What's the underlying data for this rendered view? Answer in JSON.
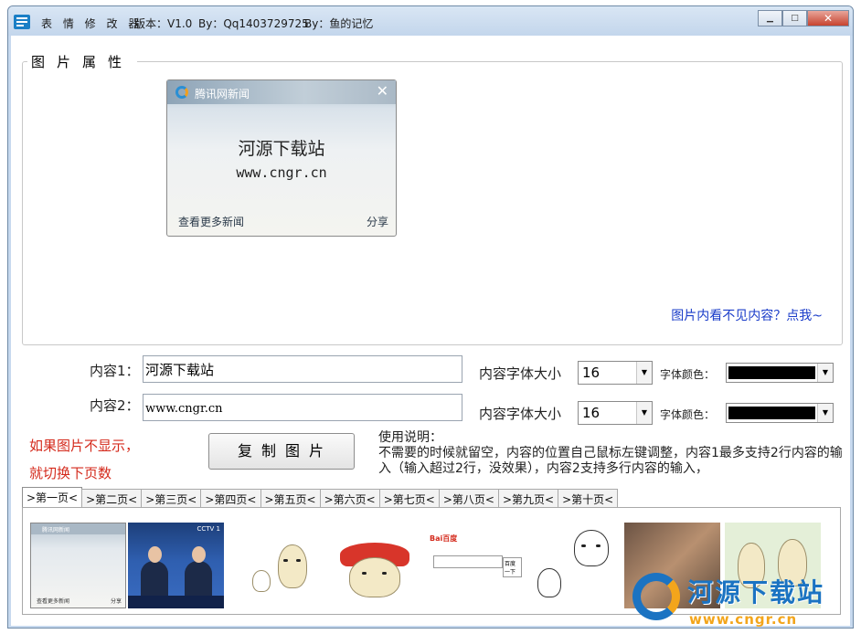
{
  "window": {
    "app_icon": "app-logo-icon",
    "title_name": "表 情 修 改 器",
    "title_version": "版本：V1.0",
    "title_by1": "By：Qq1403729725",
    "title_by2": "By：鱼的记忆",
    "controls": {
      "minimize": "▁",
      "maximize": "□",
      "close": "✕"
    }
  },
  "group": {
    "title": "图片属性"
  },
  "preview": {
    "brand": "腾讯网新闻",
    "close": "✕",
    "line1": "河源下载站",
    "line2": "www.cngr.cn",
    "more_link": "查看更多新闻",
    "share": "分享"
  },
  "help_link": "图片内看不见内容？点我~",
  "content1": {
    "label": "内容1：",
    "value": "河源下载站",
    "size_label": "内容字体大小",
    "size_value": "16",
    "color_label": "字体颜色：",
    "color_value": "#000000"
  },
  "content2": {
    "label": "内容2：",
    "value": "www.cngr.cn",
    "size_label": "内容字体大小",
    "size_value": "16",
    "color_label": "字体颜色：",
    "color_value": "#000000"
  },
  "notes": {
    "line1": "如果图片不显示，",
    "line2": "就切换下页数"
  },
  "copy_button": "复制图片",
  "usage": {
    "title": "使用说明：",
    "text": "不需要的时候就留空，内容的位置自己鼠标左键调整，内容1最多支持2行内容的输入（输入超过2行，没效果），内容2支持多行内容的输入，"
  },
  "tabs": [
    {
      "label": ">第一页<",
      "active": true
    },
    {
      "label": ">第二页<",
      "active": false
    },
    {
      "label": ">第三页<",
      "active": false
    },
    {
      "label": ">第四页<",
      "active": false
    },
    {
      "label": ">第五页<",
      "active": false
    },
    {
      "label": ">第六页<",
      "active": false
    },
    {
      "label": ">第七页<",
      "active": false
    },
    {
      "label": ">第八页<",
      "active": false
    },
    {
      "label": ">第九页<",
      "active": false
    },
    {
      "label": ">第十页<",
      "active": false
    }
  ],
  "thumbnails": {
    "t1": {
      "brand": "腾讯网新闻",
      "more": "查看更多新闻",
      "share": "分享"
    },
    "t2": {
      "channel": "CCTV 1"
    },
    "t5": {
      "logo": "Bai百度",
      "button": "百度一下"
    }
  },
  "watermark": {
    "text": "河源下载站",
    "url": "www.cngr.cn"
  },
  "colors": {
    "accent": "#1a3cc9",
    "note": "#d42a1c",
    "brand_blue": "#1b73c2",
    "brand_orange": "#f3a51b"
  }
}
